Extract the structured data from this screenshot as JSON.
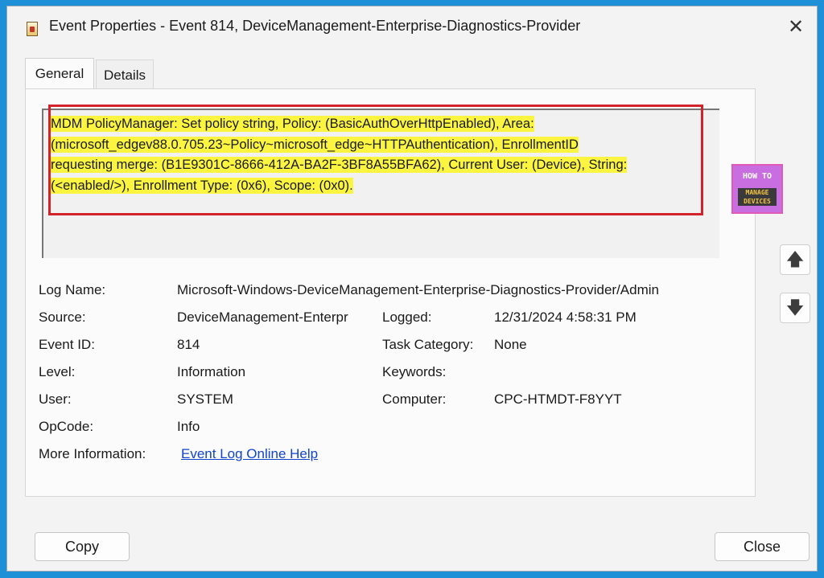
{
  "window": {
    "title": "Event Properties - Event 814, DeviceManagement-Enterprise-Diagnostics-Provider",
    "close_glyph": "✕"
  },
  "tabs": [
    {
      "label": "General",
      "selected": true
    },
    {
      "label": "Details",
      "selected": false
    }
  ],
  "description": {
    "lines": [
      "MDM PolicyManager: Set policy string, Policy: (BasicAuthOverHttpEnabled), Area:",
      "(microsoft_edgev88.0.705.23~Policy~microsoft_edge~HTTPAuthentication), EnrollmentID",
      "requesting merge: (B1E9301C-8666-412A-BA2F-3BF8A55BFA62), Current User: (Device), String:",
      "(<enabled/>), Enrollment Type: (0x6), Scope: (0x0)."
    ],
    "highlight_color": "#fbf542",
    "annotation_color": "#d2222a"
  },
  "watermark": {
    "line1": "HOW TO",
    "line2": "MANAGE DEVICES"
  },
  "nav": {
    "up_glyph": "🡅",
    "down_glyph": "🡇"
  },
  "properties": {
    "log_name_label": "Log Name:",
    "log_name_value": "Microsoft-Windows-DeviceManagement-Enterprise-Diagnostics-Provider/Admin",
    "source_label": "Source:",
    "source_value": "DeviceManagement-Enterpr",
    "logged_label": "Logged:",
    "logged_value": "12/31/2024 4:58:31 PM",
    "event_id_label": "Event ID:",
    "event_id_value": "814",
    "task_category_label": "Task Category:",
    "task_category_value": "None",
    "level_label": "Level:",
    "level_value": "Information",
    "keywords_label": "Keywords:",
    "keywords_value": "",
    "user_label": "User:",
    "user_value": "SYSTEM",
    "computer_label": "Computer:",
    "computer_value": "CPC-HTMDT-F8YYT",
    "opcode_label": "OpCode:",
    "opcode_value": "Info",
    "more_info_label": "More Information:",
    "more_info_link": "Event Log Online Help"
  },
  "buttons": {
    "copy": "Copy",
    "close": "Close"
  },
  "colors": {
    "background": "#1e90d8",
    "link": "#1144cc"
  }
}
